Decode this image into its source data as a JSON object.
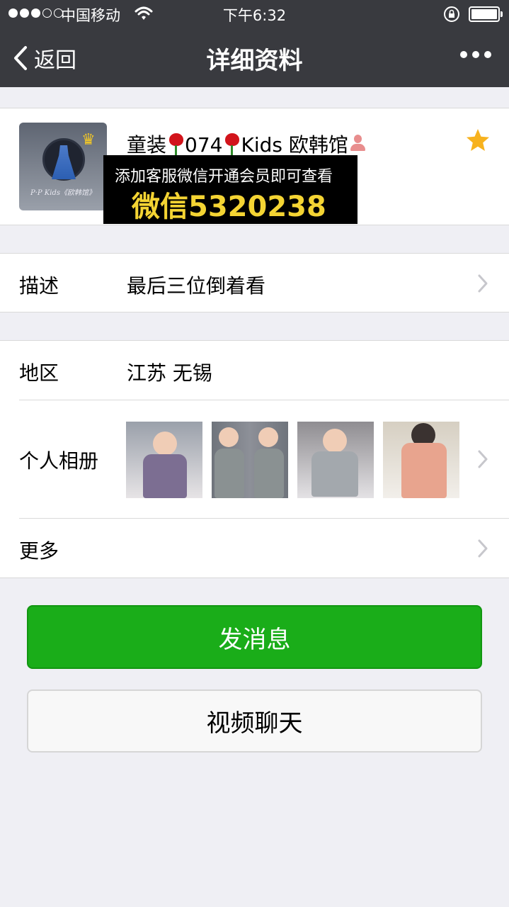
{
  "status_bar": {
    "carrier": "中国移动",
    "time": "下午6:32"
  },
  "nav": {
    "back_label": "返回",
    "title": "详细资料"
  },
  "profile": {
    "nickname_part1": "童装",
    "nickname_part2": "074",
    "nickname_part3": "Kids 欧韩馆",
    "avatar_caption": "P·P Kids《欧韩馆》",
    "starred": true
  },
  "overlay": {
    "line1": "添加客服微信开通会员即可查看",
    "line2": "微信5320238"
  },
  "cells": {
    "description": {
      "label": "描述",
      "value": "最后三位倒着看"
    },
    "region": {
      "label": "地区",
      "value": "江苏 无锡"
    },
    "album": {
      "label": "个人相册",
      "photo_count": 4
    },
    "more": {
      "label": "更多"
    }
  },
  "buttons": {
    "send_message": "发消息",
    "video_chat": "视频聊天"
  },
  "colors": {
    "nav_bg": "#393a3f",
    "primary_green": "#1aad19",
    "page_bg": "#efeff4",
    "overlay_text": "#f4d433",
    "star": "#f7b21e"
  }
}
